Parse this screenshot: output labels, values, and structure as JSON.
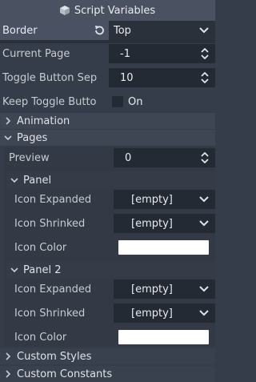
{
  "title": "Script Variables",
  "border": {
    "label": "Border",
    "value": "Top"
  },
  "current_page": {
    "label": "Current Page",
    "value": "-1"
  },
  "toggle_button_sep": {
    "label": "Toggle Button Sep",
    "value": "10"
  },
  "keep_toggle": {
    "label": "Keep Toggle Butto",
    "value": "On"
  },
  "sections": {
    "animation": "Animation",
    "pages": "Pages",
    "custom_styles": "Custom Styles",
    "custom_constants": "Custom Constants"
  },
  "preview": {
    "label": "Preview",
    "value": "0"
  },
  "panel": {
    "title": "Panel",
    "icon_expanded": {
      "label": "Icon Expanded",
      "value": "[empty]"
    },
    "icon_shrinked": {
      "label": "Icon Shrinked",
      "value": "[empty]"
    },
    "icon_color": {
      "label": "Icon Color",
      "value": "#ffffff"
    }
  },
  "panel2": {
    "title": "Panel 2",
    "icon_expanded": {
      "label": "Icon Expanded",
      "value": "[empty]"
    },
    "icon_shrinked": {
      "label": "Icon Shrinked",
      "value": "[empty]"
    },
    "icon_color": {
      "label": "Icon Color",
      "value": "#ffffff"
    }
  }
}
